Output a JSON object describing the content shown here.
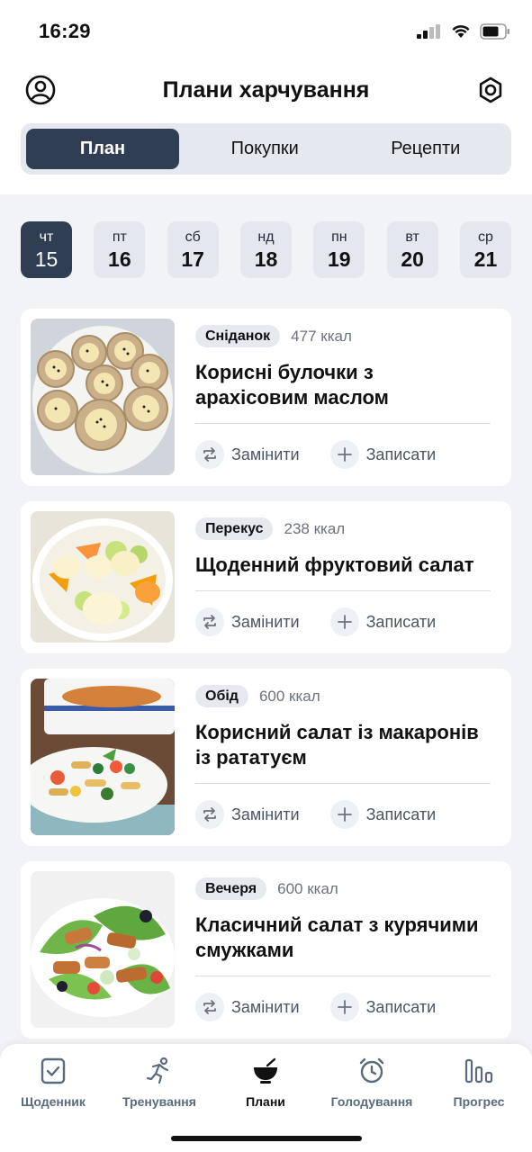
{
  "status": {
    "time": "16:29"
  },
  "header": {
    "title": "Плани харчування"
  },
  "segments": [
    "План",
    "Покупки",
    "Рецепти"
  ],
  "days": [
    {
      "name": "чт",
      "num": "15"
    },
    {
      "name": "пт",
      "num": "16"
    },
    {
      "name": "сб",
      "num": "17"
    },
    {
      "name": "нд",
      "num": "18"
    },
    {
      "name": "пн",
      "num": "19"
    },
    {
      "name": "вт",
      "num": "20"
    },
    {
      "name": "ср",
      "num": "21"
    }
  ],
  "meals": [
    {
      "tag": "Сніданок",
      "kcal": "477 ккал",
      "title": "Корисні булочки з арахісовим маслом",
      "image": "banana-rolls-photo"
    },
    {
      "tag": "Перекус",
      "kcal": "238 ккал",
      "title": "Щоденний фруктовий салат",
      "image": "fruit-salad-photo"
    },
    {
      "tag": "Обід",
      "kcal": "600 ккал",
      "title": "Корисний салат із макаронів із рататуєм",
      "image": "pasta-salad-photo"
    },
    {
      "tag": "Вечеря",
      "kcal": "600 ккал",
      "title": "Класичний салат з курячими смужками",
      "image": "chicken-salad-photo"
    }
  ],
  "actions": {
    "replace": "Замінити",
    "log": "Записати"
  },
  "tabs": [
    {
      "label": "Щоденник",
      "icon": "diary-check-icon"
    },
    {
      "label": "Тренування",
      "icon": "running-icon"
    },
    {
      "label": "Плани",
      "icon": "bowl-icon"
    },
    {
      "label": "Голодування",
      "icon": "alarm-clock-icon"
    },
    {
      "label": "Прогрес",
      "icon": "bar-chart-icon"
    }
  ],
  "colors": {
    "accent": "#2f3e52",
    "background": "#f2f3f6",
    "muted": "#6b7280"
  }
}
